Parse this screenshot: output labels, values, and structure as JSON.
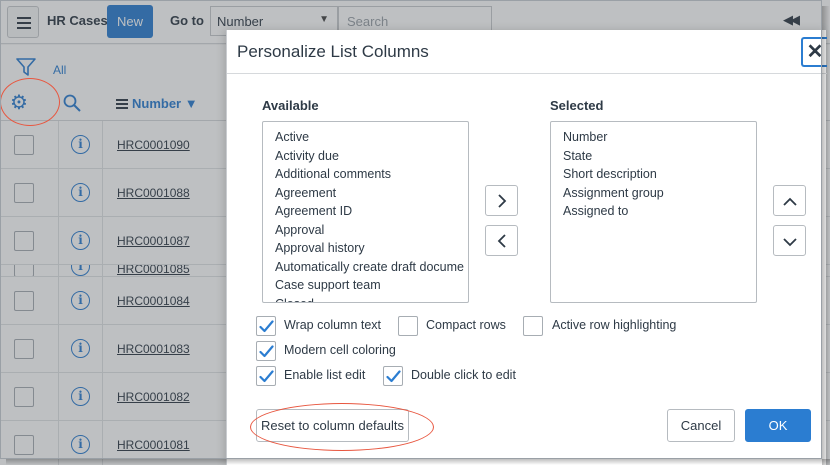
{
  "page": {
    "title": "HR Cases",
    "new_label": "New",
    "goto_label": "Go to",
    "goto_field": "Number",
    "search_placeholder": "Search",
    "filter_all": "All",
    "column_header": "Number",
    "rows": [
      "HRC0001090",
      "HRC0001088",
      "HRC0001087",
      "HRC0001085",
      "HRC0001084",
      "HRC0001083",
      "HRC0001082",
      "HRC0001081"
    ],
    "info_glyph": "i"
  },
  "modal": {
    "title": "Personalize List Columns",
    "close_glyph": "✕",
    "available_label": "Available",
    "selected_label": "Selected",
    "available": [
      "Active",
      "Activity due",
      "Additional comments",
      "Agreement",
      "Agreement ID",
      "Approval",
      "Approval history",
      "Automatically create draft docume",
      "Case support team",
      "Closed"
    ],
    "selected": [
      "Number",
      "State",
      "Short description",
      "Assignment group",
      "Assigned to"
    ],
    "options": [
      {
        "label": "Wrap column text",
        "checked": true
      },
      {
        "label": "Compact rows",
        "checked": false
      },
      {
        "label": "Active row highlighting",
        "checked": false
      },
      {
        "label": "Modern cell coloring",
        "checked": true
      },
      {
        "label": "Enable list edit",
        "checked": true
      },
      {
        "label": "Double click to edit",
        "checked": true
      }
    ],
    "reset_label": "Reset to column defaults",
    "cancel_label": "Cancel",
    "ok_label": "OK"
  },
  "colors": {
    "accent": "#2b7dd1",
    "annotation": "#e8563f"
  },
  "icons": [
    "menu-icon",
    "filter-icon",
    "gear-icon",
    "search-icon",
    "info-icon",
    "chevron-right-icon",
    "chevron-left-icon",
    "chevron-up-icon",
    "chevron-down-icon",
    "checkmark-icon",
    "rewind-icon"
  ]
}
